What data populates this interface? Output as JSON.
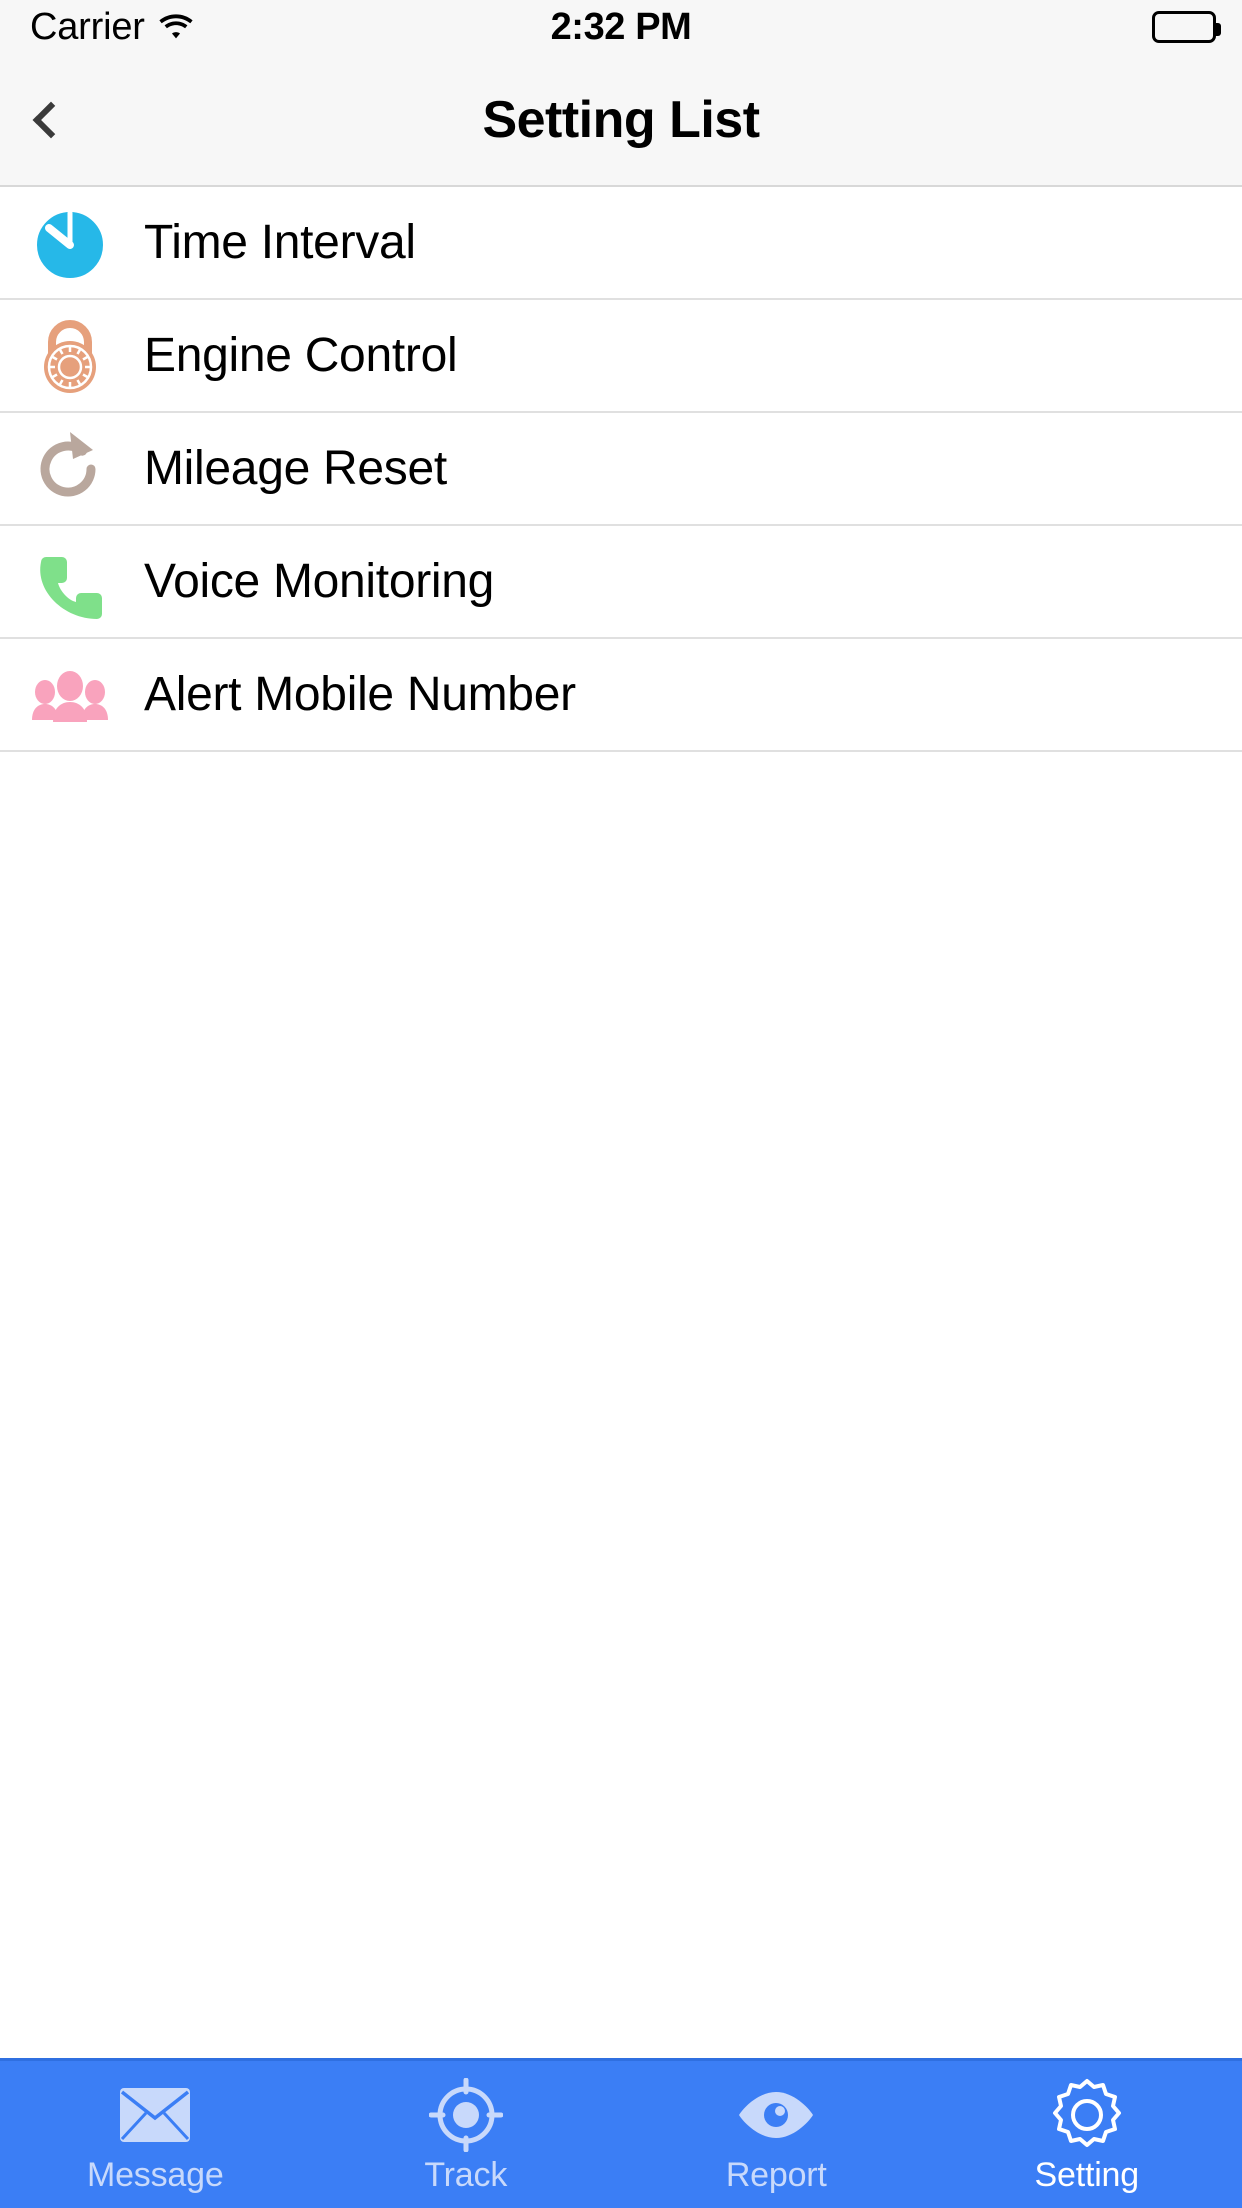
{
  "status_bar": {
    "carrier": "Carrier",
    "wifi_icon": "wifi-icon",
    "time": "2:32 PM",
    "battery_icon": "battery-full-icon"
  },
  "nav_bar": {
    "back_icon": "chevron-left-icon",
    "title": "Setting List"
  },
  "list": {
    "items": [
      {
        "label": "Time Interval",
        "icon": "clock-timer-icon",
        "color": "#26b8e8"
      },
      {
        "label": "Engine Control",
        "icon": "padlock-icon",
        "color": "#e6a07c"
      },
      {
        "label": "Mileage Reset",
        "icon": "refresh-icon",
        "color": "#b9a79d"
      },
      {
        "label": "Voice Monitoring",
        "icon": "phone-icon",
        "color": "#7fe08a"
      },
      {
        "label": "Alert Mobile Number",
        "icon": "people-group-icon",
        "color": "#f9a3bd"
      }
    ]
  },
  "tab_bar": {
    "background": "#3b7ef5",
    "active_color": "#ffffff",
    "inactive_color": "#c8d9fb",
    "tabs": [
      {
        "label": "Message",
        "icon": "envelope-icon",
        "active": false
      },
      {
        "label": "Track",
        "icon": "crosshair-icon",
        "active": false
      },
      {
        "label": "Report",
        "icon": "eye-icon",
        "active": false
      },
      {
        "label": "Setting",
        "icon": "gear-icon",
        "active": true
      }
    ]
  }
}
